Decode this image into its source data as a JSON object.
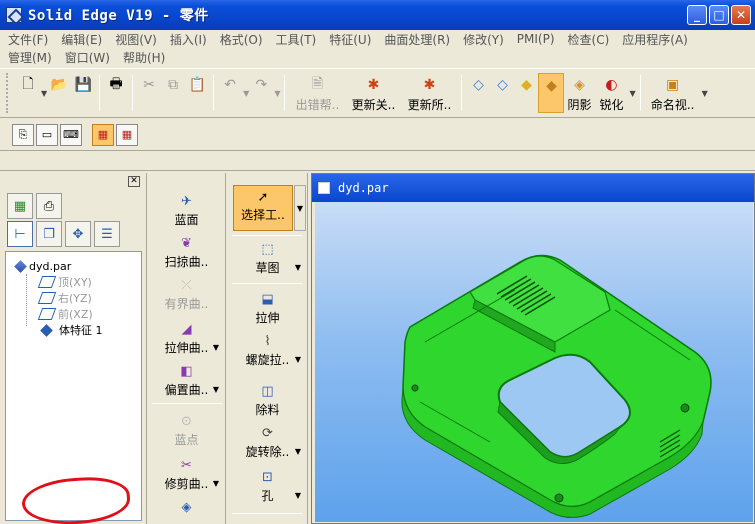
{
  "window": {
    "title": "Solid Edge V19 - 零件",
    "min": "_",
    "max": "□",
    "close": "✕"
  },
  "menus": {
    "row1": [
      "文件(F)",
      "编辑(E)",
      "视图(V)",
      "插入(I)",
      "格式(O)",
      "工具(T)",
      "特征(U)",
      "曲面处理(R)",
      "修改(Y)",
      "PMI(P)",
      "检查(C)",
      "应用程序(A)"
    ],
    "row2": [
      "管理(M)",
      "窗口(W)",
      "帮助(H)"
    ]
  },
  "toolbar": {
    "error_help": "出错帮..",
    "update_related": "更新关..",
    "update_all": "更新所..",
    "shading": "阴影",
    "sharpen": "锐化",
    "named_view": "命名视.."
  },
  "panel": {
    "close": "✕",
    "tree": {
      "root": "dyd.par",
      "items": [
        "顶(XY)",
        "右(YZ)",
        "前(XZ)"
      ],
      "feature": "体特征 1"
    }
  },
  "commands_col1": {
    "blue_surface": "蓝面",
    "sweep_surface": "扫掠曲..",
    "bounded_surface": "有界曲..",
    "extrude_surface": "拉伸曲..",
    "offset_surface": "偏置曲..",
    "blue_point": "蓝点",
    "trim_surface": "修剪曲.."
  },
  "commands_col2": {
    "select_tool": "选择工..",
    "sketch": "草图",
    "extrude": "拉伸",
    "helical_protrusion": "螺旋拉..",
    "cutout": "除料",
    "revolved_cutout": "旋转除..",
    "hole": "孔"
  },
  "document": {
    "title": "dyd.par"
  },
  "colors": {
    "model": "#2ed62e",
    "model_edge": "#0a7a0a",
    "annotation": "#e0101a",
    "highlight": "#fcc76a"
  }
}
